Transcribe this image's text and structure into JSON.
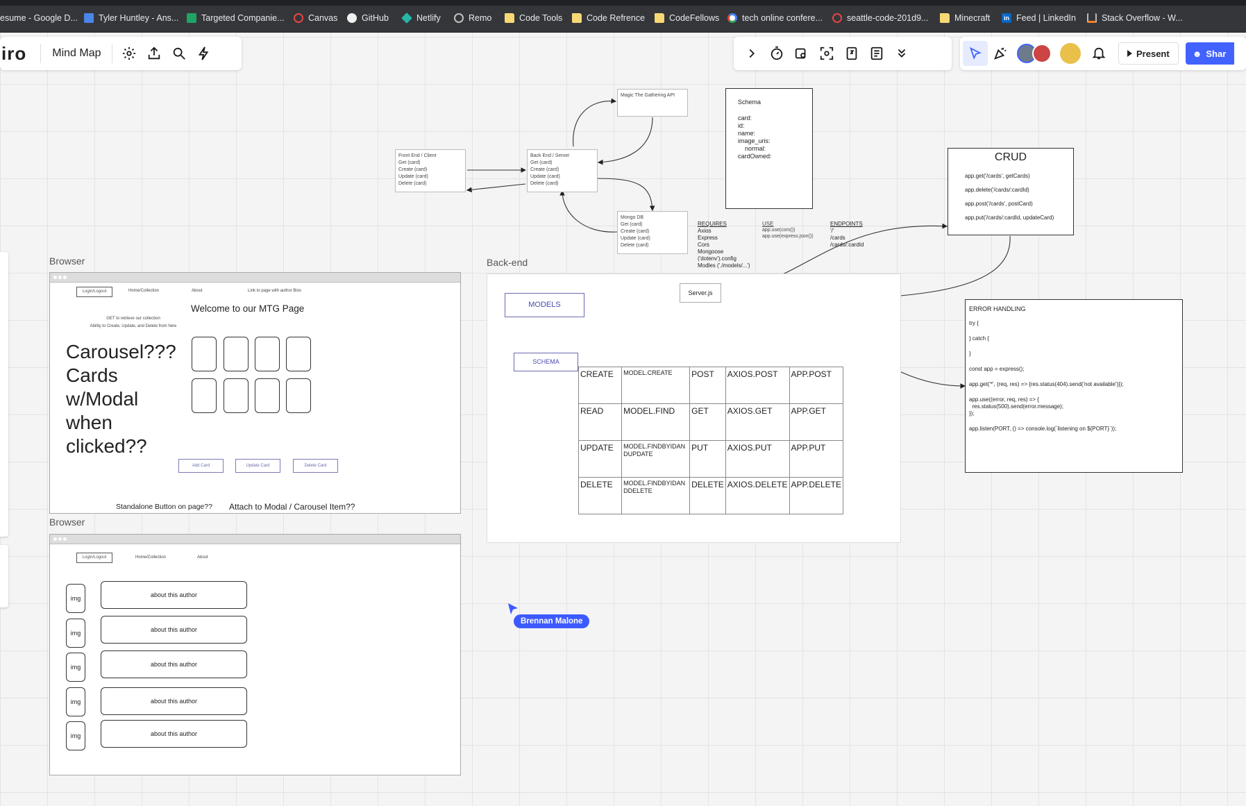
{
  "bookmarks": [
    {
      "label": "esume - Google D...",
      "icon": "doc"
    },
    {
      "label": "Tyler Huntley - Ans...",
      "icon": "doc"
    },
    {
      "label": "Targeted Companie...",
      "icon": "sheet"
    },
    {
      "label": "Canvas",
      "icon": "ring"
    },
    {
      "label": "GitHub",
      "icon": "git"
    },
    {
      "label": "Netlify",
      "icon": "netlify"
    },
    {
      "label": "Remo",
      "icon": "globe"
    },
    {
      "label": "Code Tools",
      "icon": "folder"
    },
    {
      "label": "Code Refrence",
      "icon": "folder"
    },
    {
      "label": "CodeFellows",
      "icon": "folder"
    },
    {
      "label": "tech online confere...",
      "icon": "google"
    },
    {
      "label": "seattle-code-201d9...",
      "icon": "ring"
    },
    {
      "label": "Minecraft",
      "icon": "folder"
    },
    {
      "label": "Feed | LinkedIn",
      "icon": "li"
    },
    {
      "label": "Stack Overflow - W...",
      "icon": "so"
    }
  ],
  "app": {
    "logo": "iro",
    "board_name": "Mind Map"
  },
  "topbar": {
    "present_label": "Present",
    "share_label": "Shar"
  },
  "flow": {
    "api_box": "Magic The Gathering API",
    "frontend": [
      "Front End / Client",
      "Get (card)",
      "Create (card)",
      "Update (card)",
      "Delete (card)"
    ],
    "backend": [
      "Back End / Server",
      "Get (card)",
      "Create (card)",
      "Update (card)",
      "Delete (card)"
    ],
    "mongo": [
      "Mongo DB",
      "Get (card)",
      "Create (card)",
      "Update (card)",
      "Delete (card)"
    ]
  },
  "schema_box": {
    "title": "Schema",
    "lines": [
      "card:",
      "id:",
      "name:",
      "image_uris:",
      "    normal:",
      "cardOwned:"
    ]
  },
  "requires": {
    "title": "REQUIRES",
    "lines": [
      "Axios",
      "Express",
      "Cors",
      "Mongoose",
      "('dotenv').config",
      "Modles ('./models/...')"
    ]
  },
  "use": {
    "title": "USE",
    "lines": [
      "app.use(cors())",
      "app.use(express.json())"
    ]
  },
  "endpoints": {
    "title": "ENDPOINTS",
    "lines": [
      "'/'",
      "/cards",
      "/cards/:cardId"
    ]
  },
  "crud_box": {
    "title": "CRUD",
    "lines": [
      "app.get('/cards', getCards)",
      "app.delete('/cards/:cardId)",
      "app.post('/cards', postCard)",
      "app.put('/cards/:cardId, updateCard)"
    ]
  },
  "error_box": {
    "lines": [
      "ERROR HANDLING",
      "try {",
      "} catch {",
      "}",
      "const app = express();",
      "app.get('*', (req, res) => {res.status(404).send('not available')});",
      "app.use((error, req, res) => {",
      "  res.status(500).send(error.message);",
      "});",
      "app.listen(PORT, () => console.log(`listening on ${PORT}`));"
    ]
  },
  "browser1": {
    "frame_title": "Browser",
    "nav": {
      "login": "Login/Logout",
      "home": "Home/Collection",
      "about": "About",
      "about_note": "Link to page with author Bios"
    },
    "get_note": [
      "GET to retrieve our collection",
      "Ability to Create, Update, and Delete from here"
    ],
    "welcome": "Welcome to our MTG Page",
    "carousel_text": [
      "Carousel???",
      "Cards",
      "w/Modal",
      "when",
      "clicked??"
    ],
    "buttons": [
      "Add Card",
      "Update Card",
      "Delete Card"
    ],
    "note_left": "Standalone Button on page??",
    "note_right": "Attach to Modal / Carousel Item??"
  },
  "browser2": {
    "frame_title": "Browser",
    "nav": {
      "login": "Login/Logout",
      "home": "Home/Collection",
      "about": "About"
    },
    "rows": [
      {
        "img": "img",
        "text": "about this author"
      },
      {
        "img": "img",
        "text": "about this author"
      },
      {
        "img": "img",
        "text": "about this author"
      },
      {
        "img": "img",
        "text": "about this author"
      },
      {
        "img": "img",
        "text": "about this author"
      }
    ]
  },
  "backend_frame": {
    "title": "Back-end",
    "models": "MODELS",
    "schema": "SCHEMA",
    "server": "Server.js",
    "table": [
      [
        "CREATE",
        "MODEL.CREATE",
        "POST",
        "AXIOS.POST",
        "APP.POST"
      ],
      [
        "READ",
        "MODEL.FIND",
        "GET",
        "AXIOS.GET",
        "APP.GET"
      ],
      [
        "UPDATE",
        "MODEL.FINDBYIDAN DUPDATE",
        "PUT",
        "AXIOS.PUT",
        "APP.PUT"
      ],
      [
        "DELETE",
        "MODEL.FINDBYIDAN DDELETE",
        "DELETE",
        "AXIOS.DELETE",
        "APP.DELETE"
      ]
    ]
  },
  "cursor_user": "Brennan Malone",
  "colors": {
    "accent": "#4262ff",
    "cursor": "#3d5afe",
    "sketch": "#6a6ab0"
  }
}
